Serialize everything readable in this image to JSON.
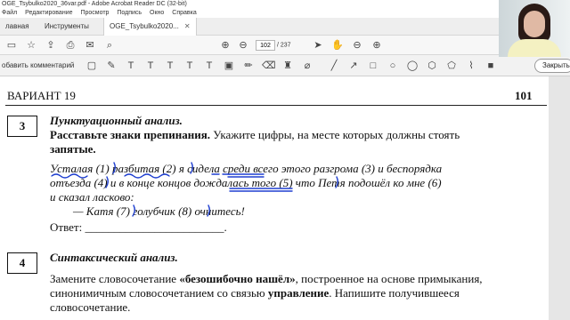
{
  "window": {
    "title": "OGE_Tsybulko2020_36var.pdf - Adobe Acrobat Reader DC (32-bit)"
  },
  "menu": [
    "Файл",
    "Редактирование",
    "Просмотр",
    "Подпись",
    "Окно",
    "Справка"
  ],
  "tabs": {
    "home": "лавная",
    "tools": "Инструменты",
    "doc": "OGE_Tsybulko2020..."
  },
  "toolbar": {
    "page_current": "102",
    "page_total": "/ 237"
  },
  "annotation_bar": {
    "add_comment": "обавить комментарий",
    "close": "Закрыть"
  },
  "document": {
    "variant": "ВАРИАНТ 19",
    "page_number": "101",
    "task3": {
      "number": "3",
      "title": "Пунктуационный анализ.",
      "instruction_bold": "Расставьте знаки препинания.",
      "instruction_rest": " Укажите цифры, на месте которых должны стоять",
      "instruction_line2": "запятые.",
      "sentence_line1": "Усталая (1) разбитая (2) я сидела среди всего этого разгрома (3) и беспорядка",
      "sentence_line2": "отъезда (4) и в конце концов дождалась того (5) что Петя подошёл ко мне (6)",
      "sentence_line3": "и сказал ласково:",
      "sentence_line4": "— Катя (7) голубчик (8) очнитесь!",
      "answer_label": "Ответ: ",
      "answer_blank": "________________________."
    },
    "task4": {
      "number": "4",
      "title": "Синтаксический анализ.",
      "line1_pre": "Замените словосочетание ",
      "line1_bold": "«безошибочно нашёл»",
      "line1_post": ", построенное на основе примыкания,",
      "line2_pre": "синонимичным словосочетанием со связью ",
      "line2_bold": "управление",
      "line2_post": ". Напишите получившееся",
      "line3": "словосочетание."
    }
  }
}
